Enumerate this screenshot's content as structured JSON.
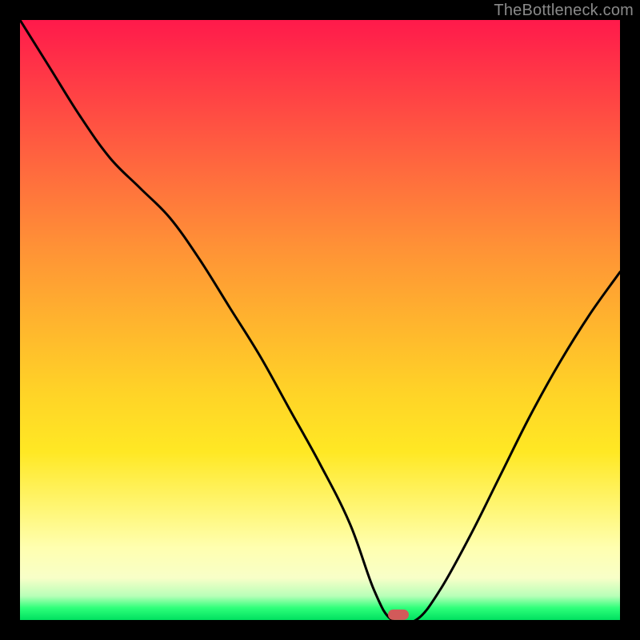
{
  "watermark": "TheBottleneck.com",
  "marker": {
    "x_pct": 63,
    "y_pct": 99.2
  },
  "chart_data": {
    "type": "line",
    "title": "",
    "xlabel": "",
    "ylabel": "",
    "xlim": [
      0,
      100
    ],
    "ylim": [
      0,
      100
    ],
    "x": [
      0,
      5,
      10,
      15,
      20,
      25,
      30,
      35,
      40,
      45,
      50,
      55,
      59,
      62,
      66,
      70,
      75,
      80,
      85,
      90,
      95,
      100
    ],
    "values": [
      100,
      92,
      84,
      77,
      72,
      67,
      60,
      52,
      44,
      35,
      26,
      16,
      5,
      0,
      0,
      5,
      14,
      24,
      34,
      43,
      51,
      58
    ],
    "annotations": [
      {
        "type": "oval_marker",
        "x": 63,
        "y": 0,
        "color": "#d25a5a"
      }
    ],
    "background_gradient": {
      "direction": "vertical",
      "stops": [
        {
          "pct": 0,
          "color": "#ff1a4b"
        },
        {
          "pct": 25,
          "color": "#ff6a3e"
        },
        {
          "pct": 50,
          "color": "#ffb32e"
        },
        {
          "pct": 72,
          "color": "#ffe824"
        },
        {
          "pct": 88,
          "color": "#ffffb0"
        },
        {
          "pct": 96,
          "color": "#b8ffb8"
        },
        {
          "pct": 100,
          "color": "#00e060"
        }
      ]
    }
  }
}
